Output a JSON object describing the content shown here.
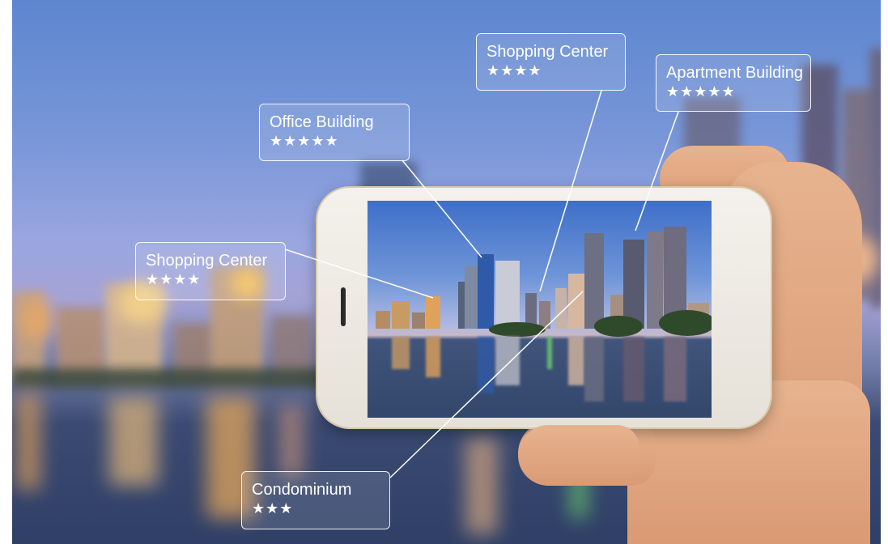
{
  "scene": {
    "description_colors": {
      "sky_top": "#5d86cf",
      "sky_mid": "#9aa6e0",
      "water": "#2f3f66",
      "city_light": "#f0b04a",
      "label_border": "#ffffff"
    }
  },
  "labels": {
    "office": {
      "name": "Office Building",
      "stars": "★★★★★",
      "rating": 5
    },
    "shopping_top": {
      "name": "Shopping Center",
      "stars": "★★★★",
      "rating": 4
    },
    "apartment": {
      "name": "Apartment Building",
      "stars": "★★★★★",
      "rating": 5
    },
    "shopping_left": {
      "name": "Shopping Center",
      "stars": "★★★★",
      "rating": 4
    },
    "condominium": {
      "name": "Condominium",
      "stars": "★★★",
      "rating": 3
    }
  }
}
